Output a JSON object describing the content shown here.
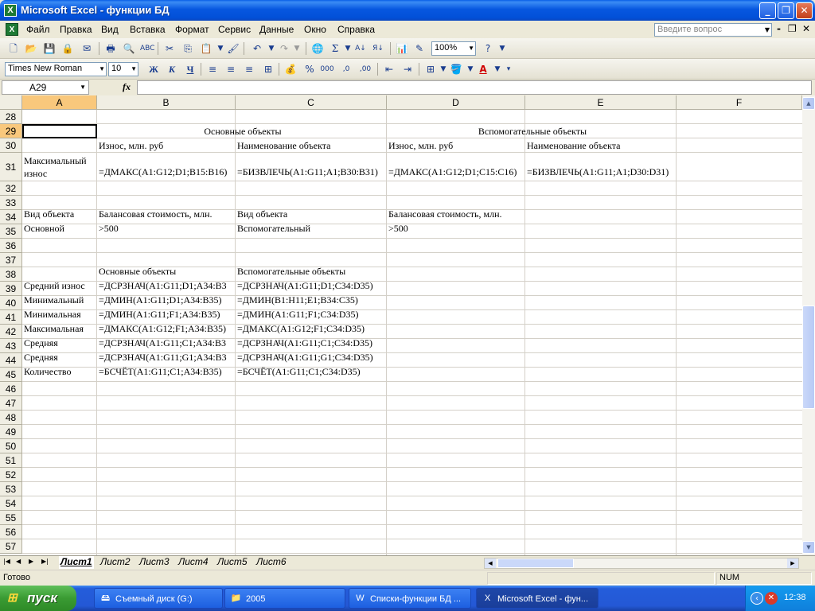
{
  "window": {
    "title": "Microsoft Excel - функции БД",
    "app_icon": "excel-icon",
    "buttons": {
      "minimize": "_",
      "maximize": "❐",
      "close": "✕"
    }
  },
  "menu": {
    "items": [
      "Файл",
      "Правка",
      "Вид",
      "Вставка",
      "Формат",
      "Сервис",
      "Данные",
      "Окно",
      "Справка"
    ],
    "ask_placeholder": "Введите вопрос",
    "mdi_controls": [
      "-",
      "❐",
      "✕"
    ]
  },
  "toolbar_standard": {
    "zoom": "100%"
  },
  "toolbar_format": {
    "font_name": "Times New Roman",
    "font_size": "10",
    "bold": "Ж",
    "italic": "К",
    "underline": "Ч"
  },
  "formula_bar": {
    "name_box": "A29",
    "fx": "fx",
    "formula": ""
  },
  "grid": {
    "columns": [
      "A",
      "B",
      "C",
      "D",
      "E",
      "F"
    ],
    "rows": [
      "28",
      "29",
      "30",
      "31",
      "32",
      "33",
      "34",
      "35",
      "36",
      "37",
      "38",
      "39",
      "40",
      "41",
      "42",
      "43",
      "44",
      "45",
      "46",
      "47",
      "48",
      "49",
      "50",
      "51",
      "52",
      "53",
      "54",
      "55",
      "56",
      "57"
    ],
    "selected_cell": "A29",
    "cells": {
      "B29": "Основные объекты",
      "D29": "Вспомогательные объекты",
      "B30": "Износ, млн. руб",
      "C30": "Наименование объекта",
      "D30": "Износ, млн. руб",
      "E30": "Наименование объекта",
      "A31": "Максимальный износ",
      "B31": "=ДМАКС(A1:G12;D1;B15:B16)",
      "C31": "=БИЗВЛЕЧЬ(A1:G11;A1;B30:B31)",
      "D31": "=ДМАКС(A1:G12;D1;C15:C16)",
      "E31": "=БИЗВЛЕЧЬ(A1:G11;A1;D30:D31)",
      "A34": "Вид объекта",
      "B34": "Балансовая стоимость, млн.",
      "C34": "Вид объекта",
      "D34": "Балансовая стоимость, млн.",
      "A35": "Основной",
      "B35": ">500",
      "C35": "Вспомогательный",
      "D35": ">500",
      "B38": "Основные объекты",
      "C38": "Вспомогательные объекты",
      "A39": "Средний износ",
      "B39": "=ДСРЗНАЧ(A1:G11;D1;A34:B3",
      "C39": "=ДСРЗНАЧ(A1:G11;D1;C34:D35)",
      "A40": "Минимальный",
      "B40": "=ДМИН(A1:G11;D1;A34:B35)",
      "C40": "=ДМИН(B1:H11;E1;B34:C35)",
      "A41": "Минимальная",
      "B41": "=ДМИН(A1:G11;F1;A34:B35)",
      "C41": "=ДМИН(A1:G11;F1;C34:D35)",
      "A42": "Максимальная",
      "B42": "=ДМАКС(A1:G12;F1;A34:B35)",
      "C42": "=ДМАКС(A1:G12;F1;C34:D35)",
      "A43": "Средняя",
      "B43": "=ДСРЗНАЧ(A1:G11;C1;A34:B3",
      "C43": "=ДСРЗНАЧ(A1:G11;C1;C34:D35)",
      "A44": "Средняя",
      "B44": "=ДСРЗНАЧ(A1:G11;G1;A34:B3",
      "C44": "=ДСРЗНАЧ(A1:G11;G1;C34:D35)",
      "A45": "Количество",
      "B45": "=БСЧЁТ(A1:G11;C1;A34:B35)",
      "C45": "=БСЧЁТ(A1:G11;C1;C34:D35)"
    }
  },
  "sheets": {
    "tabs": [
      "Лист1",
      "Лист2",
      "Лист3",
      "Лист4",
      "Лист5",
      "Лист6"
    ],
    "active": "Лист1"
  },
  "status": {
    "text": "Готово",
    "num": "NUM"
  },
  "taskbar": {
    "start": "пуск",
    "items": [
      "Съемный диск (G:)",
      "2005",
      "Списки-функции БД ...",
      "Microsoft Excel - фун..."
    ],
    "active_index": 3,
    "clock": "12:38"
  }
}
